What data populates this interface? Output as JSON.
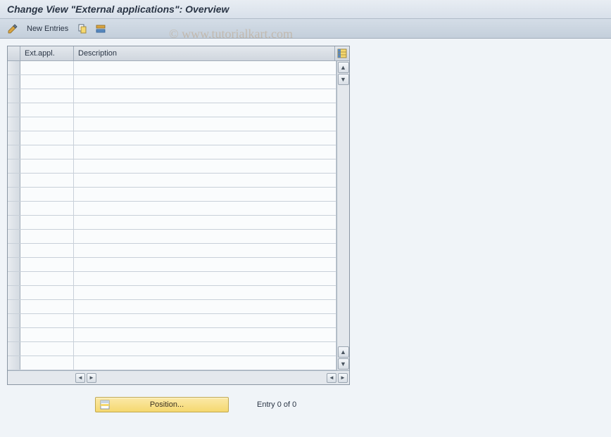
{
  "title": "Change View \"External applications\": Overview",
  "toolbar": {
    "new_entries_label": "New Entries"
  },
  "table": {
    "columns": {
      "ext_appl": "Ext.appl.",
      "description": "Description"
    },
    "row_count": 22
  },
  "footer": {
    "position_label": "Position...",
    "entry_status": "Entry 0 of 0"
  },
  "watermark": "© www.tutorialkart.com",
  "icons": {
    "pencil": "pencil-icon",
    "copy": "copy-icon",
    "delete": "delete-icon",
    "config": "config-icon",
    "up": "▲",
    "down": "▼",
    "left": "◄",
    "right": "►",
    "table_settings": "table-settings-icon"
  }
}
